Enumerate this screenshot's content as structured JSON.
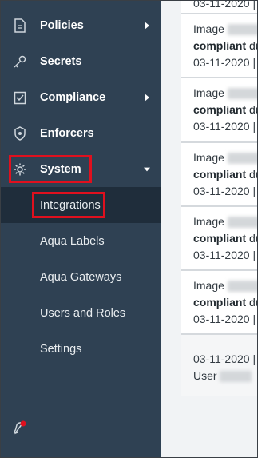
{
  "sidebar": {
    "items": [
      {
        "label": "Policies",
        "icon": "policies-icon",
        "has_chevron": true
      },
      {
        "label": "Secrets",
        "icon": "key-icon",
        "has_chevron": false
      },
      {
        "label": "Compliance",
        "icon": "clipboard-icon",
        "has_chevron": true
      },
      {
        "label": "Enforcers",
        "icon": "shield-icon",
        "has_chevron": false
      },
      {
        "label": "System",
        "icon": "gear-icon",
        "has_chevron": true
      }
    ],
    "system_children": [
      {
        "label": "Integrations"
      },
      {
        "label": "Aqua Labels"
      },
      {
        "label": "Aqua Gateways"
      },
      {
        "label": "Users and Roles"
      },
      {
        "label": "Settings"
      }
    ]
  },
  "cards": [
    {
      "line1": "Image",
      "line2": "compliant",
      "line2_tail": "du",
      "line3": "03-11-2020 |"
    },
    {
      "line1": "Image",
      "line2": "compliant",
      "line2_tail": "du",
      "line3": "03-11-2020 |"
    },
    {
      "line1": "Image",
      "line2": "compliant",
      "line2_tail": "du",
      "line3": "03-11-2020 |"
    },
    {
      "line1": "Image",
      "line2": "compliant",
      "line2_tail": "du",
      "line3": "03-11-2020 |"
    },
    {
      "line1": "Image",
      "line2": "compliant",
      "line2_tail": "du",
      "line3": "03-11-2020 |"
    }
  ],
  "top_card": {
    "text": "03-11-2020 |"
  },
  "last_card": {
    "line1": "03-11-2020 |",
    "line2": "User"
  },
  "colors": {
    "highlight": "#e0101e",
    "sidebar_bg": "#2f4153",
    "notification_dot": "#e0101e"
  }
}
